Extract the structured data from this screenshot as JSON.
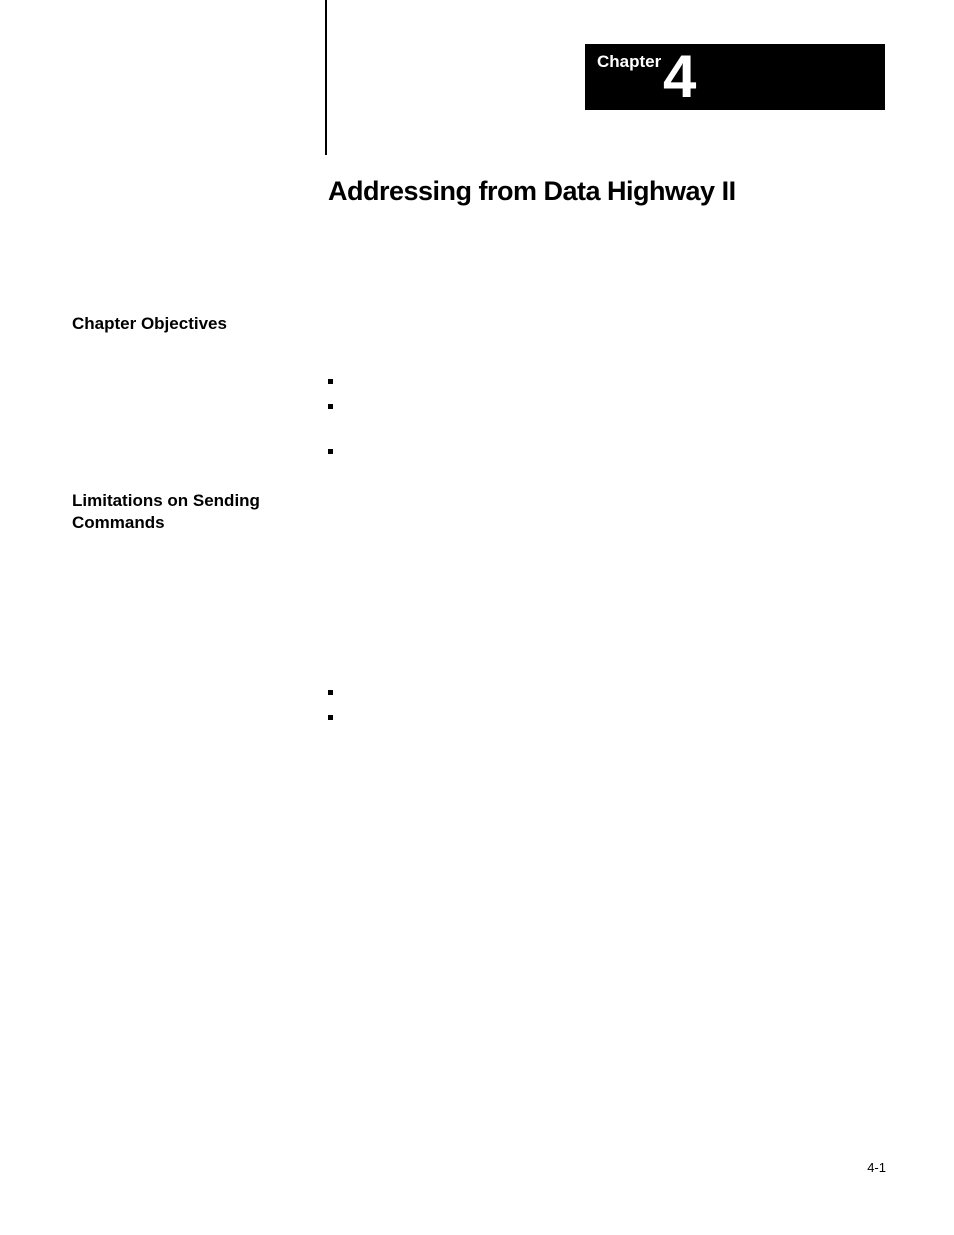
{
  "banner": {
    "label": "Chapter",
    "number": "4"
  },
  "title": "Addressing from Data Highway II",
  "sidebar": {
    "heading1": "Chapter Objectives",
    "heading2": "Limitations on Sending Commands"
  },
  "footer": {
    "page_number": "4-1"
  }
}
